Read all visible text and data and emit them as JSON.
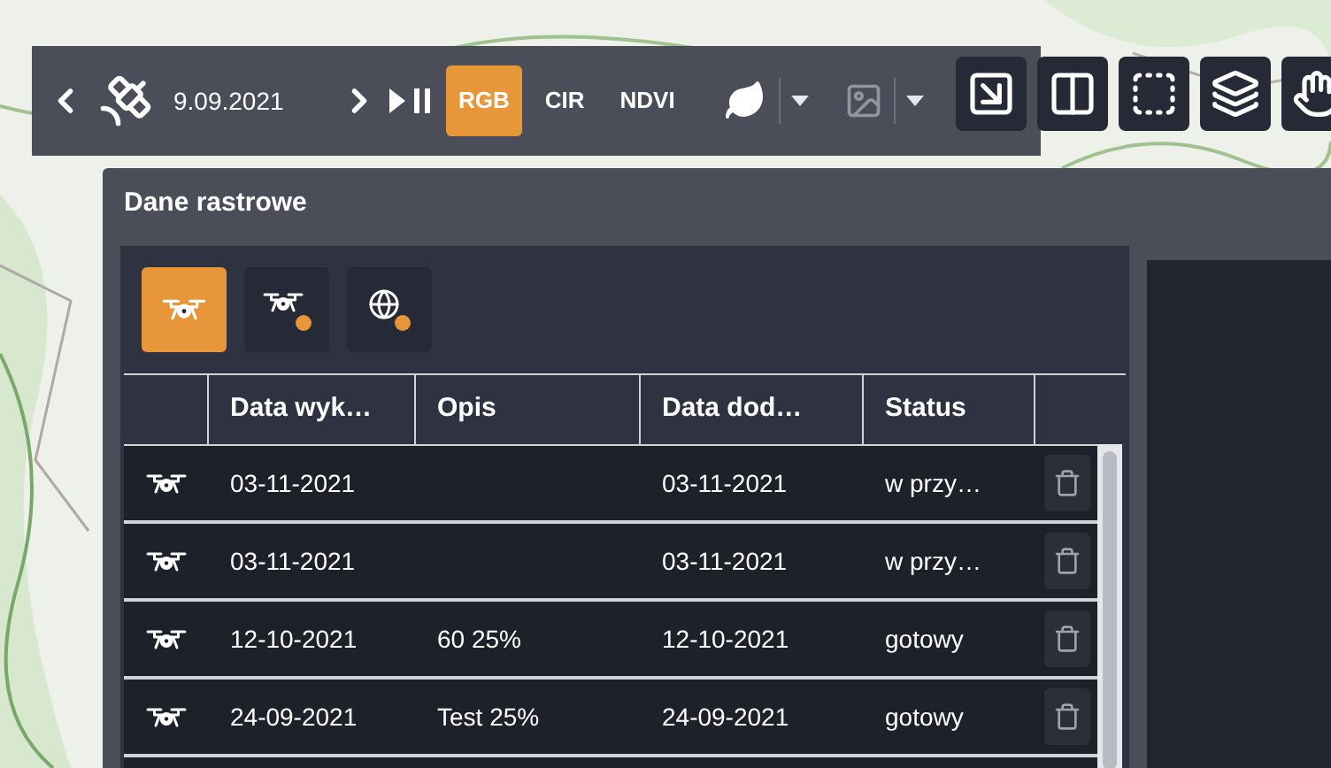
{
  "toolbar": {
    "date": "9.09.2021",
    "modes": [
      {
        "label": "RGB",
        "selected": true
      },
      {
        "label": "CIR",
        "selected": false
      },
      {
        "label": "NDVI",
        "selected": false
      }
    ],
    "image_search": {
      "disabled": true
    }
  },
  "panel": {
    "title": "Dane rastrowe",
    "tabs": [
      {
        "kind": "drone",
        "selected": true
      },
      {
        "kind": "drone-alert",
        "selected": false
      },
      {
        "kind": "globe-alert",
        "selected": false
      }
    ],
    "table": {
      "columns": [
        "Data wyk…",
        "Opis",
        "Data dod…",
        "Status"
      ],
      "rows": [
        {
          "cells": [
            "03-11-2021",
            "",
            "03-11-2021",
            "w przy…"
          ]
        },
        {
          "cells": [
            "03-11-2021",
            "",
            "03-11-2021",
            "w przy…"
          ]
        },
        {
          "cells": [
            "12-10-2021",
            "60 25%",
            "12-10-2021",
            "gotowy"
          ]
        },
        {
          "cells": [
            "24-09-2021",
            "Test 25%",
            "24-09-2021",
            "gotowy"
          ]
        }
      ]
    }
  }
}
